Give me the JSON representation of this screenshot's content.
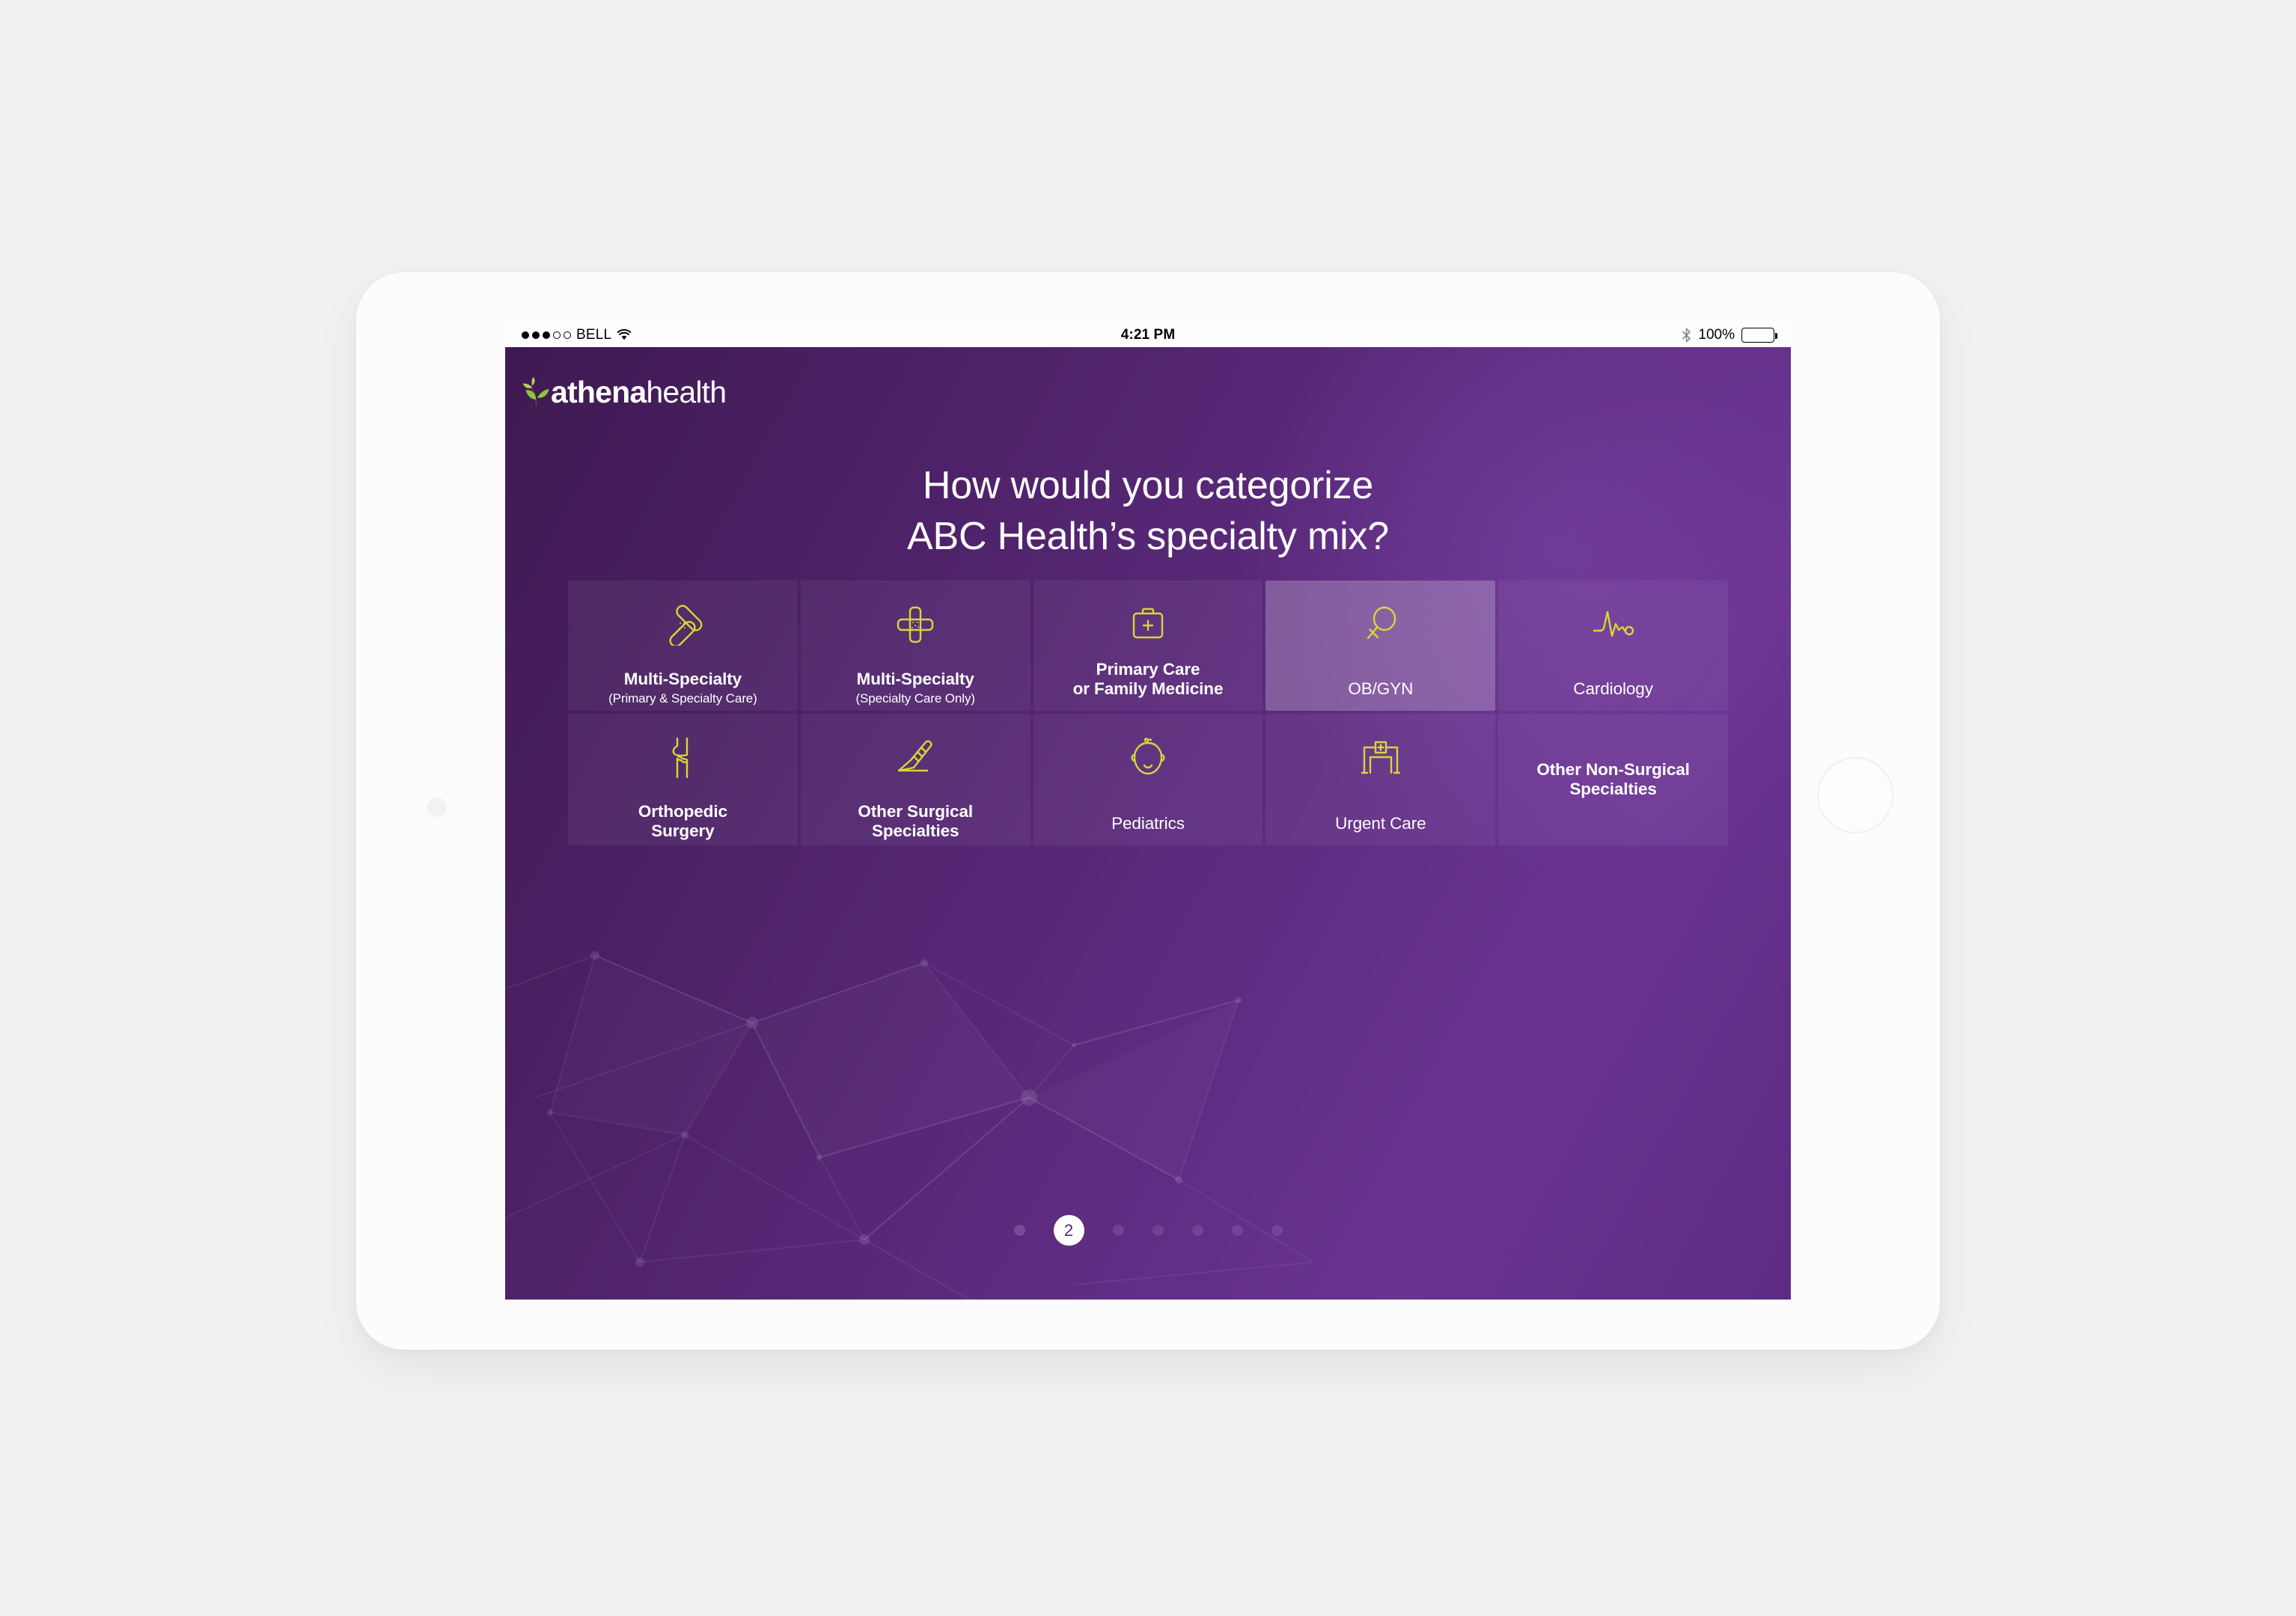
{
  "status_bar": {
    "carrier": "BELL",
    "signal_dots_filled": 3,
    "signal_dots_total": 5,
    "wifi_icon": "wifi-icon",
    "time": "4:21 PM",
    "bluetooth_icon": "bluetooth-icon",
    "battery_percent": "100%",
    "battery_icon": "battery-full-icon"
  },
  "brand": {
    "logo_mark": "athena-leaf-icon",
    "name_bold": "athena",
    "name_light": "health"
  },
  "headline": {
    "line1": "How would you categorize",
    "line2": "ABC Health’s specialty mix?"
  },
  "colors": {
    "background_start": "#3e1a51",
    "background_end": "#6a3292",
    "tile": "rgba(255,255,255,0.055)",
    "tile_selected": "rgba(255,255,255,0.235)",
    "icon_accent": "#d3d935",
    "text": "#ffffff",
    "pager_active_text": "#512b7a"
  },
  "tiles": [
    {
      "icon": "bandage-cross-icon",
      "label": "Multi-Specialty",
      "sublabel": "(Primary & Specialty Care)",
      "selected": false
    },
    {
      "icon": "bandage-plus-icon",
      "label": "Multi-Specialty",
      "sublabel": "(Specialty Care Only)",
      "selected": false
    },
    {
      "icon": "medical-bag-icon",
      "label_line1": "Primary Care",
      "label_line2": "or Family Medicine",
      "selected": false
    },
    {
      "icon": "female-symbol-icon",
      "label": "OB/GYN",
      "selected": true
    },
    {
      "icon": "heartbeat-ekg-icon",
      "label": "Cardiology",
      "selected": false
    },
    {
      "icon": "knee-joint-icon",
      "label_line1": "Orthopedic",
      "label_line2": "Surgery",
      "selected": false
    },
    {
      "icon": "scalpel-icon",
      "label_line1": "Other Surgical",
      "label_line2": "Specialties",
      "selected": false
    },
    {
      "icon": "baby-face-icon",
      "label": "Pediatrics",
      "selected": false
    },
    {
      "icon": "hospital-building-icon",
      "label": "Urgent Care",
      "selected": false
    },
    {
      "icon": null,
      "label_line1": "Other Non-Surgical",
      "label_line2": "Specialties",
      "selected": false
    }
  ],
  "pager": {
    "current_page": "2",
    "total_pages": 7
  }
}
